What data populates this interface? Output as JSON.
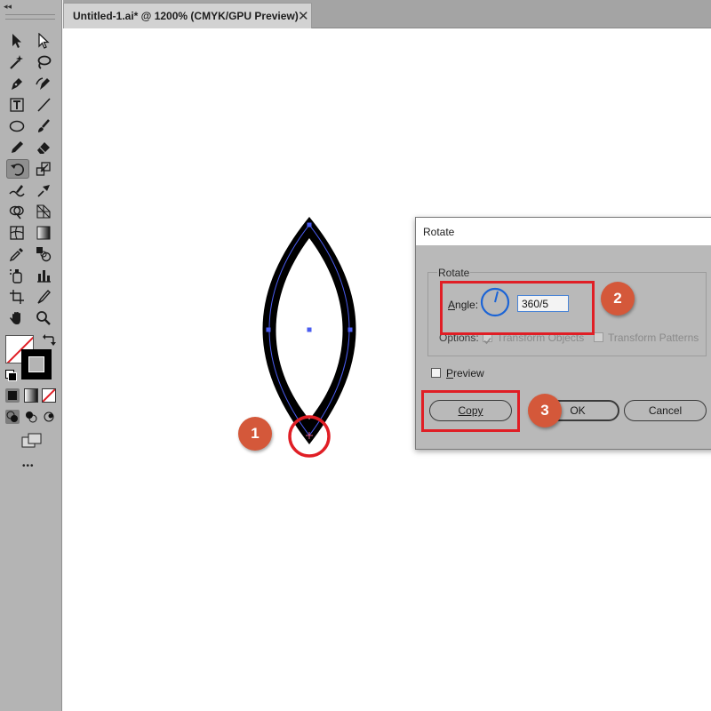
{
  "document_tab": {
    "title": "Untitled-1.ai* @ 1200% (CMYK/GPU Preview)",
    "close_glyph": "✕"
  },
  "toolbar": {
    "collapse_glyph": "◂◂",
    "more_glyph": "•••",
    "active_tool": "rotate-tool",
    "tools": [
      "selection-tool",
      "direct-selection-tool",
      "magic-wand-tool",
      "lasso-tool",
      "pen-tool",
      "curvature-tool",
      "type-tool",
      "line-segment-tool",
      "ellipse-tool",
      "paintbrush-tool",
      "pencil-tool",
      "eraser-tool",
      "rotate-tool",
      "scale-tool",
      "warp-tool",
      "free-transform-tool",
      "shape-builder-tool",
      "perspective-grid-tool",
      "mesh-tool",
      "gradient-tool",
      "eyedropper-tool",
      "blend-tool",
      "symbol-sprayer-tool",
      "column-graph-tool",
      "artboard-tool",
      "slice-tool",
      "hand-tool",
      "zoom-tool"
    ]
  },
  "callouts": {
    "one": "1",
    "two": "2",
    "three": "3"
  },
  "colors": {
    "callout": "#d4583a",
    "highlight_box": "#e01e25",
    "path_selection": "#4a5cf0",
    "dial": "#1b64d6"
  },
  "rotate_dialog": {
    "title": "Rotate",
    "group_label": "Rotate",
    "angle_label_prefix": "A",
    "angle_label_rest": "ngle:",
    "angle_value": "360/5",
    "options_label": "Options:",
    "transform_objects_label": "Transform Objects",
    "transform_objects_checked": true,
    "transform_patterns_label": "Transform Patterns",
    "transform_patterns_checked": false,
    "preview_label_prefix": "P",
    "preview_label_rest": "review",
    "preview_checked": false,
    "copy_button": "Copy",
    "ok_button": "OK",
    "cancel_button": "Cancel"
  }
}
